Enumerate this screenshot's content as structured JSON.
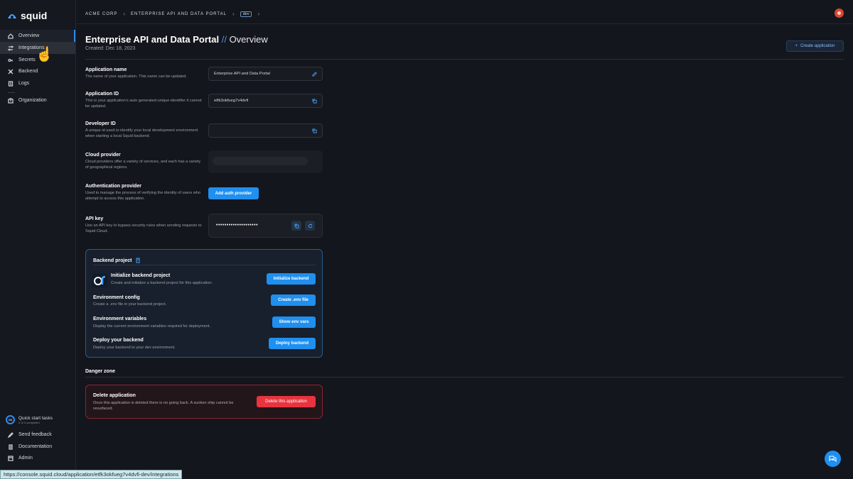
{
  "app": {
    "logo_text": "squid"
  },
  "sidebar": {
    "items": [
      {
        "label": "Overview",
        "icon": "home-icon"
      },
      {
        "label": "Integrations",
        "icon": "integrations-icon"
      },
      {
        "label": "Secrets",
        "icon": "key-icon"
      },
      {
        "label": "Backend",
        "icon": "backend-icon"
      },
      {
        "label": "Logs",
        "icon": "logs-icon"
      },
      {
        "label": "Organization",
        "icon": "building-icon"
      }
    ],
    "quick_start": {
      "title": "Quick start tasks",
      "sub": "0 of 3 completed",
      "ring": "0/6"
    },
    "bottom": [
      {
        "label": "Send feedback",
        "icon": "feedback-icon"
      },
      {
        "label": "Documentation",
        "icon": "docs-icon"
      },
      {
        "label": "Admin",
        "icon": "admin-icon"
      }
    ]
  },
  "breadcrumb": {
    "org": "ACME CORP",
    "app": "ENTERPRISE API AND DATA PORTAL",
    "env": "dev"
  },
  "header": {
    "title": "Enterprise API and Data Portal",
    "separator": "//",
    "subtitle": "Overview",
    "created": "Created: Dec 18, 2023",
    "create_button": "Create application"
  },
  "fields": {
    "app_name": {
      "label": "Application name",
      "desc": "The name of your application. This name can be updated.",
      "value": "Enterprise API and Data Portal"
    },
    "app_id": {
      "label": "Application ID",
      "desc": "This is your application's auto generated unique identifier it cannot be updated.",
      "value": "etfk3okfueg7v4dvfi"
    },
    "dev_id": {
      "label": "Developer ID",
      "desc": "A unique id used to identify your local development environment when starting a local Squid backend.",
      "value": ""
    },
    "cloud": {
      "label": "Cloud provider",
      "desc": "Cloud providers offer a variety of services, and each has a variety of geographical regions."
    },
    "auth": {
      "label": "Authentication provider",
      "desc": "Used to manage the process of verifying the identity of users who attempt to access this application.",
      "button": "Add auth provider"
    },
    "api_key": {
      "label": "API key",
      "desc": "Use an API key to bypass security rules when sending requests to Squid Cloud.",
      "value": "••••••••••••••••••••"
    }
  },
  "backend_project": {
    "title": "Backend project",
    "rows": [
      {
        "title": "Initialize backend project",
        "desc": "Create and initialize a backend project for this application.",
        "button": "Initialize backend"
      },
      {
        "title": "Environment config",
        "desc": "Create a .env file in your backend project.",
        "button": "Create .env file"
      },
      {
        "title": "Environment variables",
        "desc": "Display the current environment variables required for deployment.",
        "button": "Show env vars"
      },
      {
        "title": "Deploy your backend",
        "desc": "Deploy your backend to your dev environment.",
        "button": "Deploy backend"
      }
    ]
  },
  "danger_zone": {
    "title": "Danger zone",
    "delete_title": "Delete application",
    "delete_desc": "Once this application is deleted there is no going back. A sunken ship cannot be resurfaced.",
    "delete_button": "Delete this application"
  },
  "status_bar": {
    "url": "https://console.squid.cloud/application/etfk3okfueg7v4dvfi-dev/integrations"
  },
  "colors": {
    "accent": "#1f8ff0",
    "danger": "#e8343f",
    "background": "#13161c"
  }
}
